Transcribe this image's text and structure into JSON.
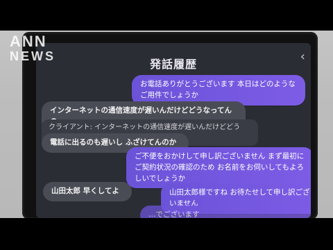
{
  "watermark": {
    "line1": "ANN",
    "line2": "NEWS"
  },
  "header": {
    "title": "発話履歴",
    "back_icon": "chevron-left-icon"
  },
  "messages": [
    {
      "side": "right",
      "text": "お電話ありがとうございます 本日はどのようなご用件でしょうか"
    },
    {
      "side": "left",
      "text": "インターネットの通信速度が遅いんだけどどうなってんの"
    },
    {
      "side": "preview",
      "text": "クライアント: インターネットの通信速度が遅いんだけどどうな…"
    },
    {
      "side": "left",
      "text": "電話に出るのも遅いし ふざけてんのか"
    },
    {
      "side": "right",
      "text": "ご不便をおかけして申し訳ございません まず最初にご契約状況の確認のため お名前をお伺いしてもよろしいでしょうか"
    },
    {
      "side": "left",
      "text": "山田太郎 早くしてよ"
    },
    {
      "side": "right",
      "text": "山田太郎様ですね お待たせして申し訳ございません"
    },
    {
      "side": "right",
      "text": "…でございます"
    }
  ]
}
